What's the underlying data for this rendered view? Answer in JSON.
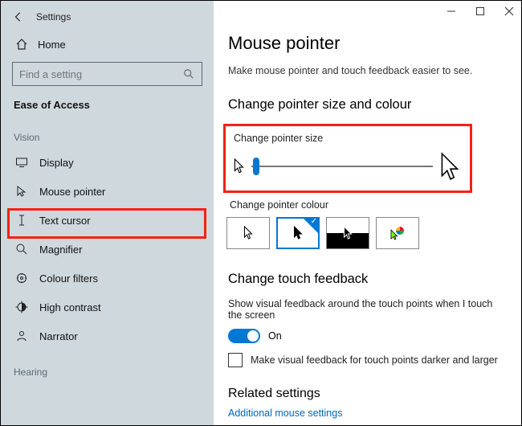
{
  "window": {
    "title": "Settings"
  },
  "sidebar": {
    "home": "Home",
    "search_placeholder": "Find a setting",
    "section": "Ease of Access",
    "group_vision": "Vision",
    "group_hearing": "Hearing",
    "items": [
      {
        "label": "Display"
      },
      {
        "label": "Mouse pointer"
      },
      {
        "label": "Text cursor"
      },
      {
        "label": "Magnifier"
      },
      {
        "label": "Colour filters"
      },
      {
        "label": "High contrast"
      },
      {
        "label": "Narrator"
      }
    ]
  },
  "page": {
    "title": "Mouse pointer",
    "subtitle": "Make mouse pointer and touch feedback easier to see.",
    "section_size": "Change pointer size and colour",
    "size_label": "Change pointer size",
    "colour_label": "Change pointer colour",
    "section_touch": "Change touch feedback",
    "touch_desc": "Show visual feedback around the touch points when I touch the screen",
    "toggle_on": "On",
    "check_label": "Make visual feedback for touch points darker and larger",
    "related": "Related settings",
    "link": "Additional mouse settings"
  }
}
